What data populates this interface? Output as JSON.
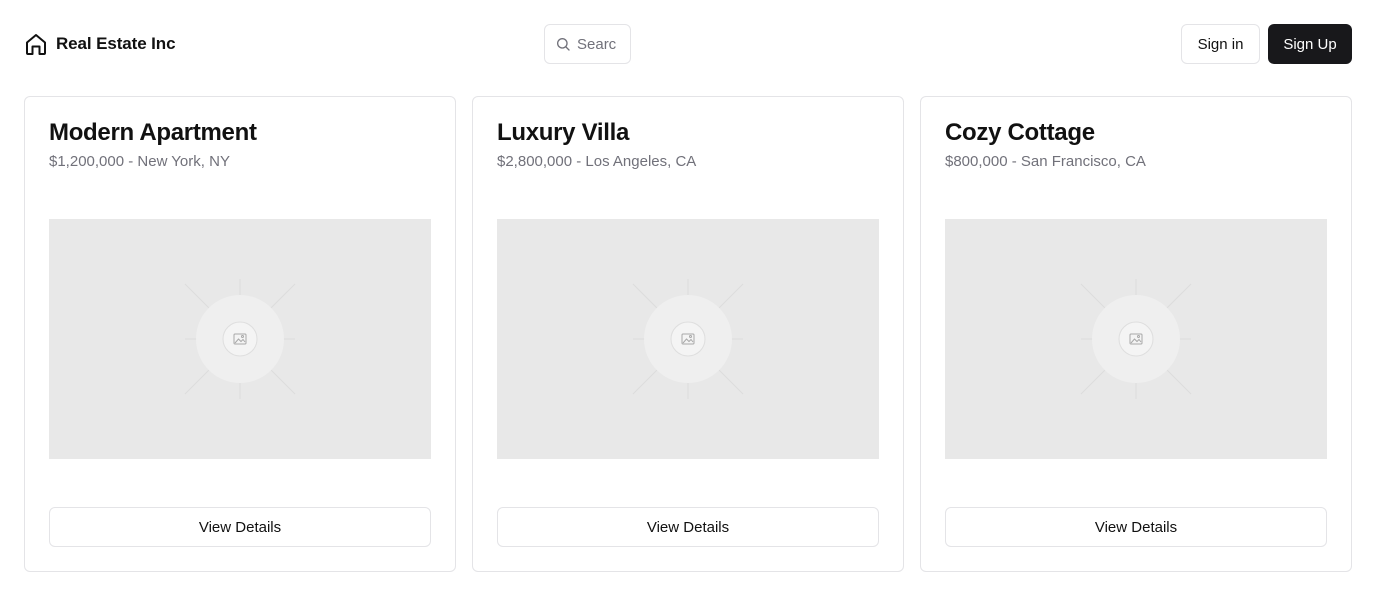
{
  "header": {
    "brand_name": "Real Estate Inc",
    "brand_icon": "home-icon",
    "search_placeholder": "Search",
    "search_icon": "search-icon",
    "signin_label": "Sign in",
    "signup_label": "Sign Up"
  },
  "listings": [
    {
      "title": "Modern Apartment",
      "subtitle": "$1,200,000 - New York, NY",
      "button_label": "View Details",
      "image_icon": "image-placeholder-icon"
    },
    {
      "title": "Luxury Villa",
      "subtitle": "$2,800,000 - Los Angeles, CA",
      "button_label": "View Details",
      "image_icon": "image-placeholder-icon"
    },
    {
      "title": "Cozy Cottage",
      "subtitle": "$800,000 - San Francisco, CA",
      "button_label": "View Details",
      "image_icon": "image-placeholder-icon"
    }
  ],
  "colors": {
    "primary_button_bg": "#18181b",
    "muted_text": "#71717a",
    "border": "#e4e4e7",
    "image_placeholder_bg": "#e8e8e8"
  }
}
